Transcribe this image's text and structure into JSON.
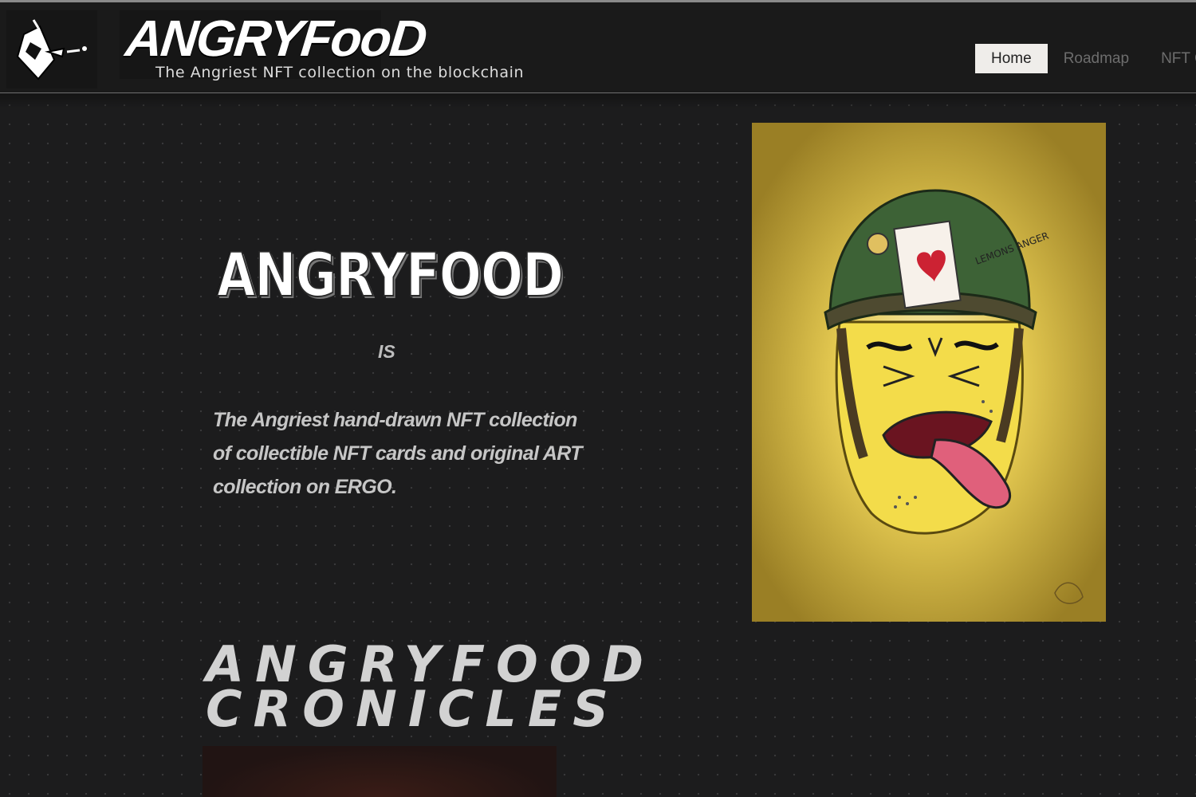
{
  "header": {
    "brand_name": "ANGRYFooD",
    "tagline": "The Angriest NFT collection on the blockchain"
  },
  "nav": {
    "items": [
      {
        "label": "Home",
        "active": true
      },
      {
        "label": "Roadmap",
        "active": false
      },
      {
        "label": "NFT C",
        "active": false
      }
    ]
  },
  "hero": {
    "title": "ANGRYFOOD",
    "connector": "IS",
    "description": "The Angriest hand-drawn NFT collection of collectible NFT cards and original ART collection on ERGO."
  },
  "artwork": {
    "hat_text": "LEMONS ANGER",
    "icon": "angry-lemon-soldier-icon"
  },
  "chronicles": {
    "title_line1": "ANGRYFOOD",
    "title_line2": "CRONICLES"
  },
  "colors": {
    "background": "#1c1c1d",
    "nav_active_bg": "#efedea",
    "art_bg": "#c9a83a",
    "lemon": "#f3dc4a",
    "helmet": "#3d6236",
    "tongue": "#e0607b"
  }
}
